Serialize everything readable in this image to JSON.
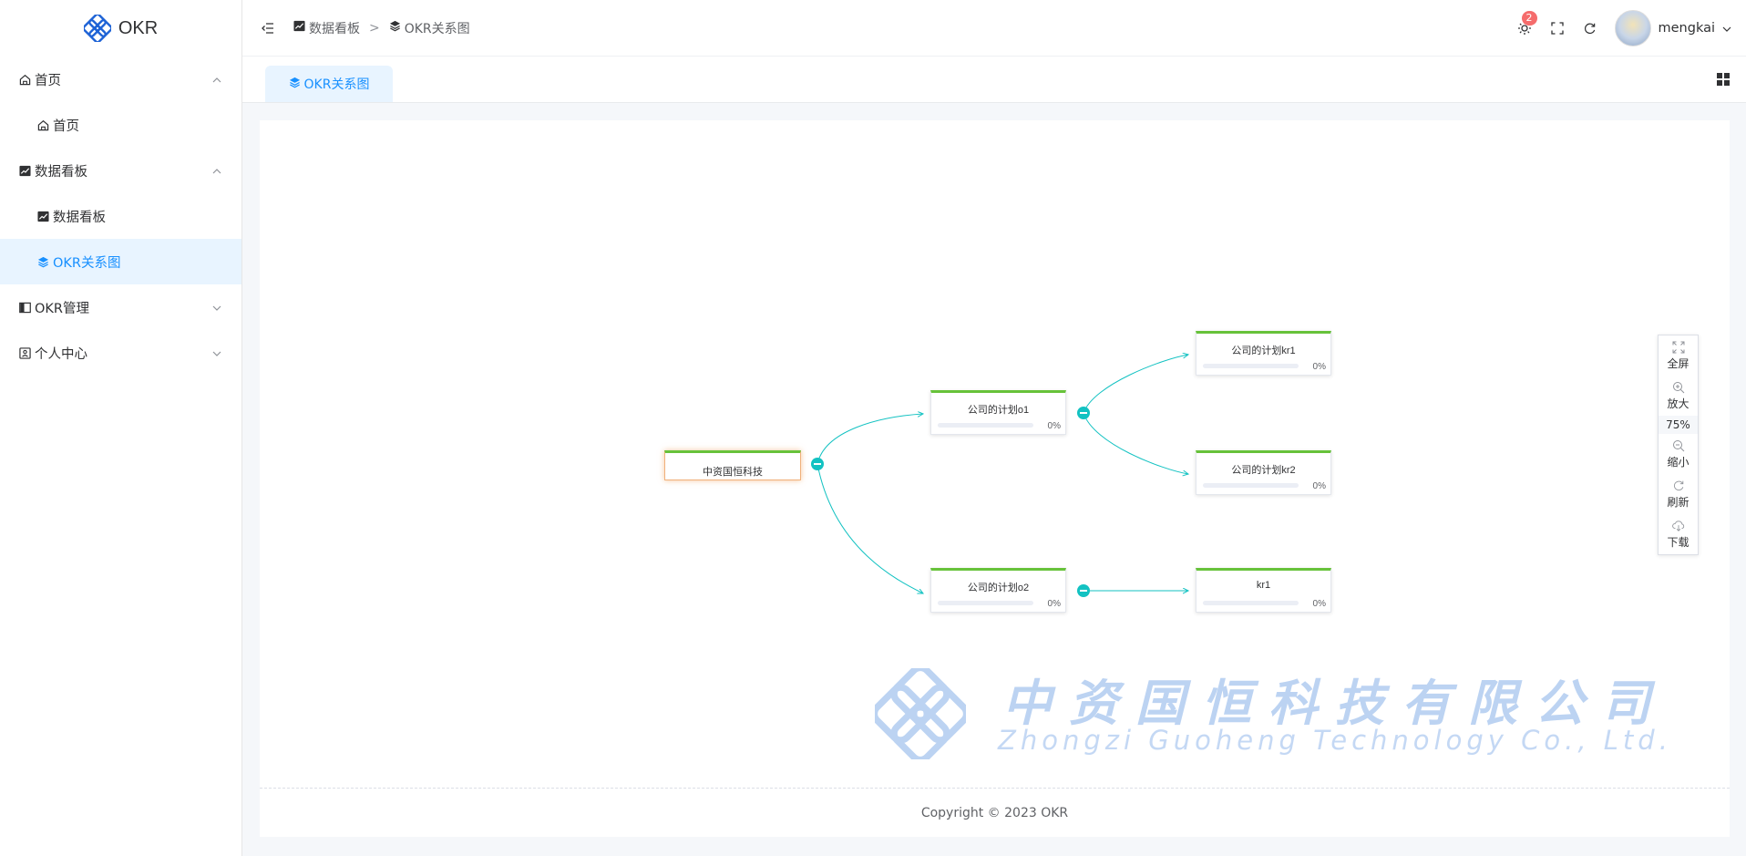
{
  "app": {
    "logo_text": "OKR"
  },
  "sidebar": {
    "items": [
      {
        "label": "首页",
        "icon": "home-icon",
        "expanded": true
      },
      {
        "label": "首页",
        "icon": "home-icon"
      },
      {
        "label": "数据看板",
        "icon": "chart-icon",
        "expanded": true
      },
      {
        "label": "数据看板",
        "icon": "chart-icon"
      },
      {
        "label": "OKR关系图",
        "icon": "layers-icon",
        "active": true
      },
      {
        "label": "OKR管理",
        "icon": "book-icon",
        "expanded": false
      },
      {
        "label": "个人中心",
        "icon": "user-card-icon",
        "expanded": false
      }
    ]
  },
  "header": {
    "breadcrumb": [
      {
        "label": "数据看板",
        "icon": "chart-icon"
      },
      {
        "label": "OKR关系图",
        "icon": "layers-icon"
      }
    ],
    "breadcrumb_separator": ">",
    "notification_count": "2",
    "username": "mengkai"
  },
  "tabs": [
    {
      "label": "OKR关系图",
      "icon": "layers-icon",
      "active": true
    }
  ],
  "graph": {
    "root": {
      "title": "中资国恒科技"
    },
    "objectives": [
      {
        "title": "公司的计划o1",
        "progress_text": "0%",
        "progress": 0
      },
      {
        "title": "公司的计划o2",
        "progress_text": "0%",
        "progress": 0
      }
    ],
    "key_results": [
      {
        "title": "公司的计划kr1",
        "progress_text": "0%",
        "progress": 0
      },
      {
        "title": "公司的计划kr2",
        "progress_text": "0%",
        "progress": 0
      },
      {
        "title": "kr1",
        "progress_text": "0%",
        "progress": 0
      }
    ],
    "colors": {
      "node_top": "#67c23a",
      "edge": "#13c2c2",
      "root_glow": "#f0a05a"
    }
  },
  "toolbar": {
    "fullscreen": "全屏",
    "zoom_in": "放大",
    "zoom_level": "75%",
    "zoom_out": "缩小",
    "refresh": "刷新",
    "download": "下载"
  },
  "watermark": {
    "cn": "中资国恒科技有限公司",
    "en": "Zhongzi Guoheng Technology Co., Ltd."
  },
  "footer": {
    "copyright": "Copyright © 2023 OKR"
  },
  "theme": {
    "accent": "#1890ff",
    "active_bg": "#e8f4ff",
    "badge": "#f56c6c"
  }
}
